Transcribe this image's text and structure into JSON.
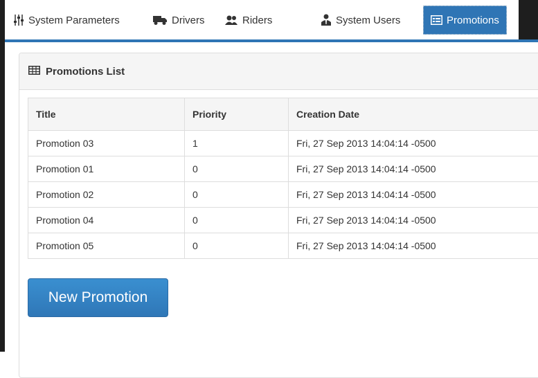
{
  "nav": {
    "tabs": [
      {
        "label": "System Parameters",
        "icon": "sliders-icon",
        "active": false
      },
      {
        "label": "Drivers",
        "icon": "truck-icon",
        "active": false
      },
      {
        "label": "Riders",
        "icon": "users-icon",
        "active": false
      },
      {
        "label": "System Users",
        "icon": "user-tie-icon",
        "active": false
      },
      {
        "label": "Promotions",
        "icon": "list-card-icon",
        "active": true
      }
    ]
  },
  "panel": {
    "title": "Promotions List",
    "title_icon": "table-icon"
  },
  "table": {
    "columns": [
      "Title",
      "Priority",
      "Creation Date"
    ],
    "rows": [
      [
        "Promotion 03",
        "1",
        "Fri, 27 Sep 2013 14:04:14 -0500"
      ],
      [
        "Promotion 01",
        "0",
        "Fri, 27 Sep 2013 14:04:14 -0500"
      ],
      [
        "Promotion 02",
        "0",
        "Fri, 27 Sep 2013 14:04:14 -0500"
      ],
      [
        "Promotion 04",
        "0",
        "Fri, 27 Sep 2013 14:04:14 -0500"
      ],
      [
        "Promotion 05",
        "0",
        "Fri, 27 Sep 2013 14:04:14 -0500"
      ]
    ]
  },
  "actions": {
    "new_label": "New Promotion"
  },
  "colors": {
    "accent": "#2f75b5",
    "sidebar": "#1e1e1e"
  }
}
